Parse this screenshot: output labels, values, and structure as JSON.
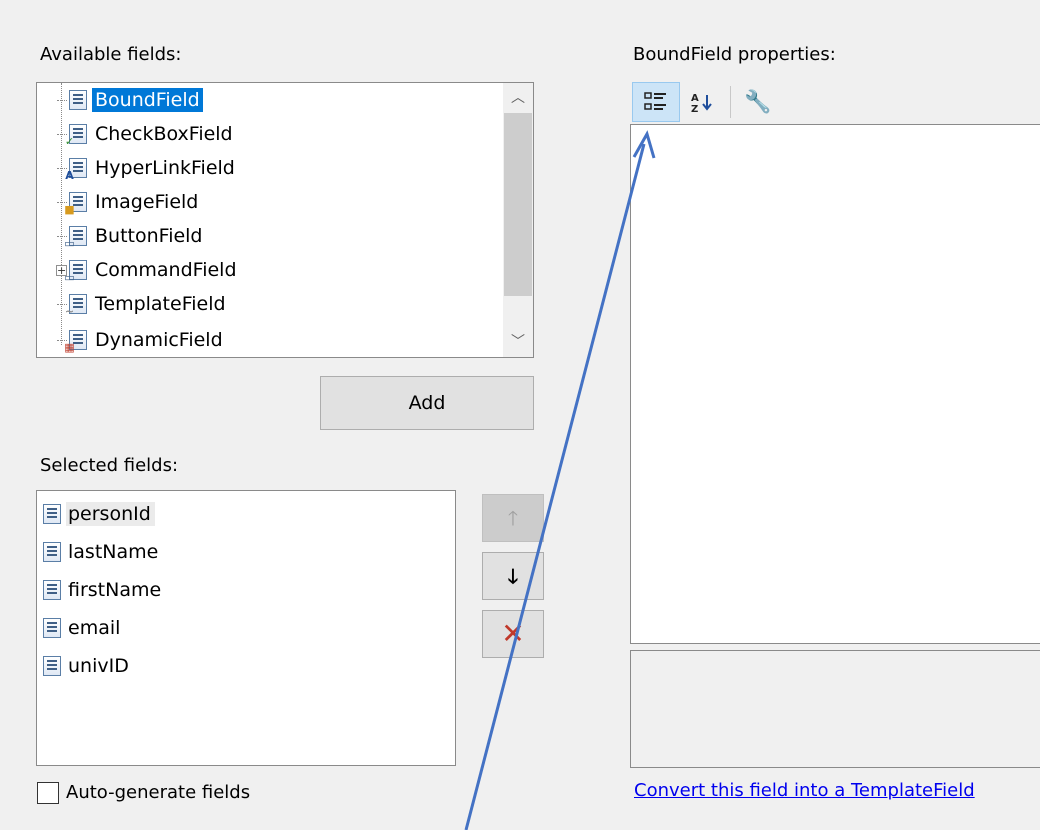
{
  "available": {
    "label": "Available fields:",
    "items": [
      "BoundField",
      "CheckBoxField",
      "HyperLinkField",
      "ImageField",
      "ButtonField",
      "CommandField",
      "TemplateField",
      "DynamicField"
    ],
    "icons": [
      "boundfield-icon",
      "checkboxfield-icon",
      "hyperlinkfield-icon",
      "imagefield-icon",
      "buttonfield-icon",
      "commandfield-icon",
      "templatefield-icon",
      "dynamicfield-icon"
    ],
    "selected_index": 0
  },
  "add_button": "Add",
  "selected": {
    "label": "Selected fields:",
    "items": [
      "personId",
      "lastName",
      "firstName",
      "email",
      "univID"
    ]
  },
  "auto_generate": {
    "label": "Auto-generate fields",
    "checked": false
  },
  "properties": {
    "label": "BoundField properties:",
    "toolbar": [
      "categorized-icon",
      "alphabetical-icon",
      "property-pages-icon"
    ]
  },
  "convert_link": "Convert this field into a TemplateField",
  "colors": {
    "selection": "#0078d7",
    "arrow": "#4472c4",
    "link": "#0000ee",
    "delete": "#c0392b"
  }
}
